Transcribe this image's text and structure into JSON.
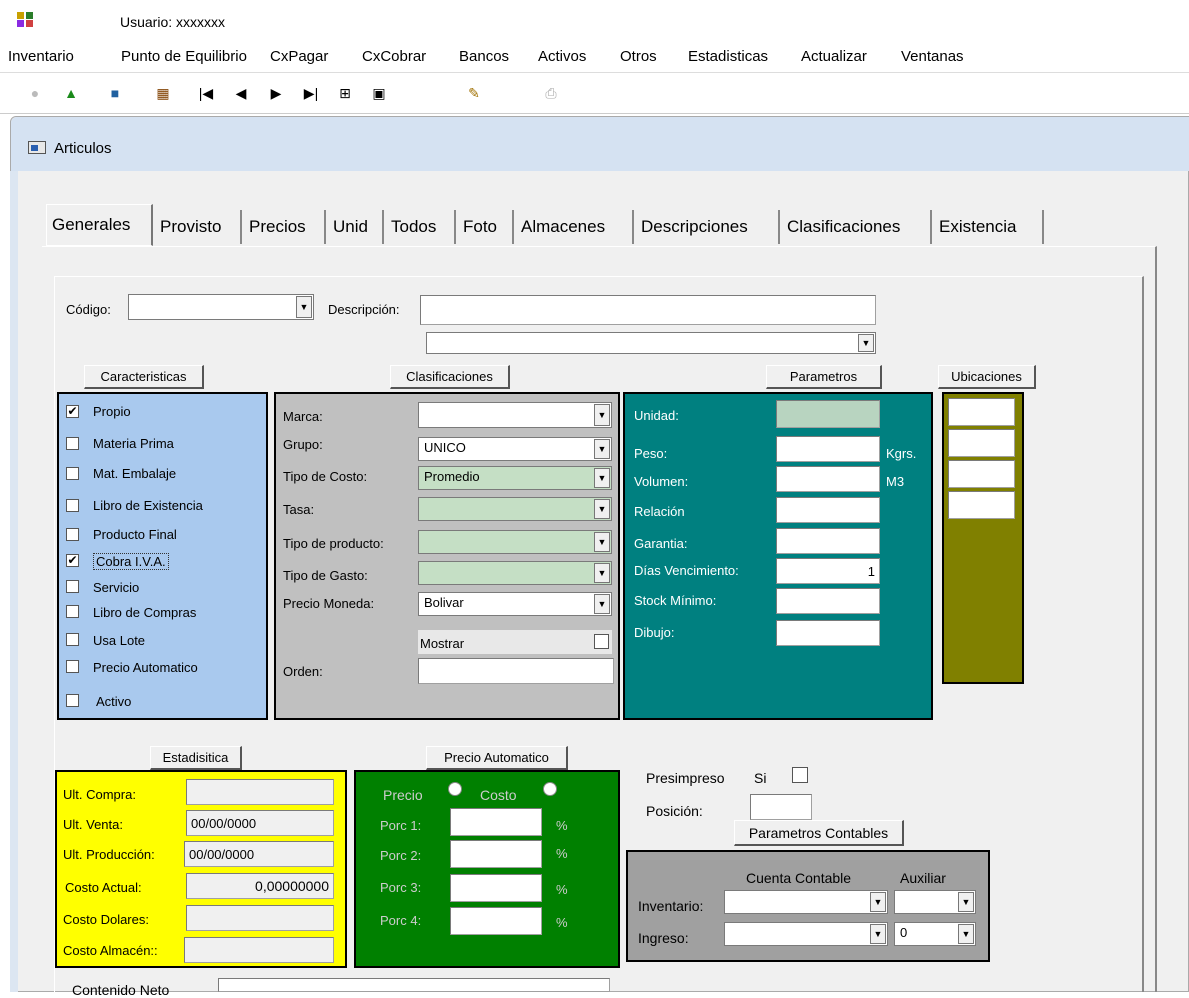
{
  "user": "Usuario: xxxxxxx",
  "menu": [
    "Inventario",
    "Punto de Equilibrio",
    "CxPagar",
    "CxCobrar",
    "Bancos",
    "Activos",
    "Otros",
    "Estadisticas",
    "Actualizar",
    "Ventanas"
  ],
  "window_title": "Articulos",
  "tabs": [
    "Generales",
    "Provisto",
    "Precios",
    "Unid",
    "Todos",
    "Foto",
    "Almacenes",
    "Descripciones",
    "Clasificaciones",
    "Existencia"
  ],
  "header": {
    "codigo_label": "Código:",
    "codigo_value": "",
    "descripcion_label": "Descripción:",
    "descripcion_value": "",
    "descripcion2_value": ""
  },
  "caracteristicas": {
    "title": "Caracteristicas",
    "items": [
      {
        "label": "Propio",
        "checked": true
      },
      {
        "label": "Materia Prima",
        "checked": false
      },
      {
        "label": "Mat. Embalaje",
        "checked": false
      },
      {
        "label": "Libro de Existencia",
        "checked": false
      },
      {
        "label": "Producto Final",
        "checked": false
      },
      {
        "label": "Cobra I.V.A.",
        "checked": true
      },
      {
        "label": "Servicio",
        "checked": false
      },
      {
        "label": "Libro de Compras",
        "checked": false
      },
      {
        "label": "Usa Lote",
        "checked": false
      },
      {
        "label": "Precio Automatico",
        "checked": false
      },
      {
        "label": "Activo",
        "checked": false
      }
    ],
    "color": "#a9c9ee"
  },
  "clasificaciones": {
    "title": "Clasificaciones",
    "marca_label": "Marca:",
    "marca_value": "",
    "grupo_label": "Grupo:",
    "grupo_value": "UNICO",
    "tipo_costo_label": "Tipo de Costo:",
    "tipo_costo_value": "Promedio",
    "tasa_label": "Tasa:",
    "tasa_value": "",
    "tipo_producto_label": "Tipo de producto:",
    "tipo_producto_value": "",
    "tipo_gasto_label": "Tipo de Gasto:",
    "tipo_gasto_value": "",
    "precio_moneda_label": "Precio Moneda:",
    "precio_moneda_value": "Bolivar",
    "mostrar_label": "Mostrar",
    "orden_label": "Orden:",
    "orden_value": "",
    "color": "#c0c0c0"
  },
  "parametros": {
    "title": "Parametros",
    "unidad_label": "Unidad:",
    "unidad_value": "",
    "peso_label": "Peso:",
    "peso_value": "",
    "peso_unit": "Kgrs.",
    "volumen_label": "Volumen:",
    "volumen_value": "",
    "volumen_unit": "M3",
    "relacion_label": "Relación",
    "relacion_value": "",
    "garantia_label": "Garantia:",
    "garantia_value": "",
    "dias_label": "Días Vencimiento:",
    "dias_value": "1",
    "stock_label": "Stock Mínimo:",
    "stock_value": "",
    "dibujo_label": "Dibujo:",
    "dibujo_value": "",
    "color": "#008080"
  },
  "ubicaciones": {
    "title": "Ubicaciones",
    "color": "#808000"
  },
  "estadistica": {
    "title": "Estadisitica",
    "ult_compra_label": "Ult. Compra:",
    "ult_compra_value": "",
    "ult_venta_label": "Ult. Venta:",
    "ult_venta_value": "00/00/0000",
    "ult_produccion_label": "Ult. Producción:",
    "ult_produccion_value": "00/00/0000",
    "costo_actual_label": "Costo Actual:",
    "costo_actual_value": "0,00000000",
    "costo_dolares_label": "Costo Dolares:",
    "costo_dolares_value": "",
    "costo_almacen_label": "Costo Almacén::",
    "costo_almacen_value": "",
    "color": "#ffff00"
  },
  "precio_automatico": {
    "title": "Precio Automatico",
    "precio_label": "Precio",
    "costo_label": "Costo",
    "porc1_label": "Porc 1:",
    "porc2_label": "Porc 2:",
    "porc3_label": "Porc 3:",
    "porc4_label": "Porc 4:",
    "pct": "%",
    "color": "#008000"
  },
  "presimpreso": {
    "label": "Presimpreso",
    "si_label": "Si",
    "posicion_label": "Posición:"
  },
  "contables": {
    "title": "Parametros Contables",
    "cuenta_label": "Cuenta Contable",
    "auxiliar_label": "Auxiliar",
    "inventario_label": "Inventario:",
    "ingreso_label": "Ingreso:",
    "ingreso_aux_value": "0",
    "color": "#a0a0a0"
  },
  "contenido_label": "Contenido Neto"
}
